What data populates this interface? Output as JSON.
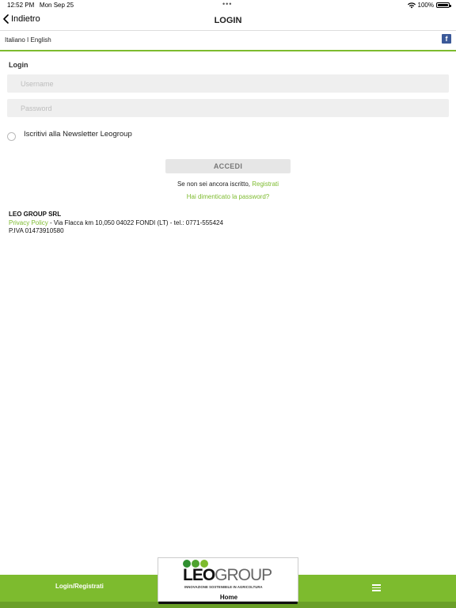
{
  "status_bar": {
    "time": "12:52 PM",
    "date": "Mon Sep 25",
    "battery": "100%",
    "multitask_dots": "•••"
  },
  "nav": {
    "back_label": "Indietro",
    "title": "LOGIN"
  },
  "language": {
    "italiano": "Italiano",
    "separator": "I",
    "english": "English"
  },
  "facebook": {
    "icon_letter": "f",
    "color": "#3b5998"
  },
  "form": {
    "section_label": "Login",
    "username_placeholder": "Username",
    "password_placeholder": "Password",
    "newsletter_label": "Iscritivi alla Newsletter Leogroup",
    "submit_label": "ACCEDI",
    "register_prompt": "Se non sei ancora iscritto,",
    "register_link": "Registrati",
    "forgot_link": "Hai dimenticato la password?"
  },
  "footer": {
    "company": "LEO GROUP SRL",
    "privacy_link": "Privacy Policy",
    "address": " - Via Flacca km 10,050 04022 FONDI (LT) - tel.: 0771-555424",
    "vat": "P.IVA 01473910580"
  },
  "tab_bar": {
    "login_tab": "Login/Registrati",
    "home_tab": "Home",
    "logo_leo": "LEO",
    "logo_group": "GROUP",
    "logo_tagline": "INNOVAZIONE SOSTENIBILE IN AGRICOLTURA"
  },
  "colors": {
    "accent": "#7dbb2e",
    "accent_dark": "#6a9f28",
    "field_bg": "#efefef"
  }
}
